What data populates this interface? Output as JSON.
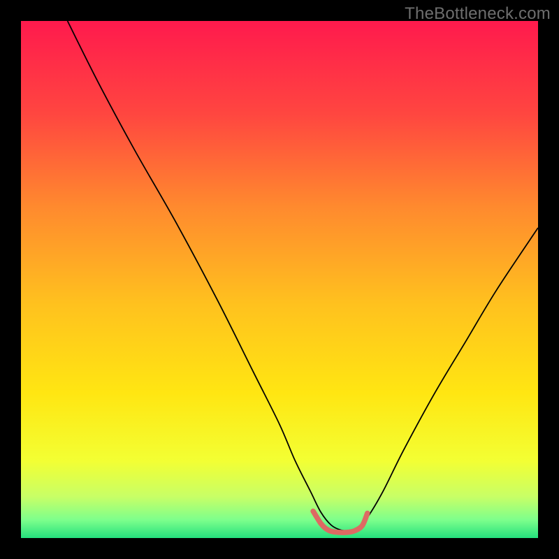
{
  "watermark": "TheBottleneck.com",
  "chart_data": {
    "type": "line",
    "title": "",
    "xlabel": "",
    "ylabel": "",
    "xlim": [
      0,
      100
    ],
    "ylim": [
      0,
      100
    ],
    "grid": false,
    "legend": false,
    "background_gradient_stops": [
      {
        "offset": 0.0,
        "color": "#ff1a4d"
      },
      {
        "offset": 0.18,
        "color": "#ff4640"
      },
      {
        "offset": 0.36,
        "color": "#ff8a2e"
      },
      {
        "offset": 0.55,
        "color": "#ffc21e"
      },
      {
        "offset": 0.72,
        "color": "#ffe612"
      },
      {
        "offset": 0.85,
        "color": "#f3ff33"
      },
      {
        "offset": 0.92,
        "color": "#c8ff66"
      },
      {
        "offset": 0.965,
        "color": "#7dff8c"
      },
      {
        "offset": 1.0,
        "color": "#24e07d"
      }
    ],
    "series": [
      {
        "name": "bottleneck-curve",
        "color": "#000000",
        "width": 1.8,
        "x": [
          9.0,
          15.0,
          22.0,
          30.0,
          38.0,
          45.0,
          50.0,
          53.0,
          56.0,
          58.0,
          60.0,
          62.0,
          63.5,
          65.0,
          67.0,
          70.0,
          74.0,
          80.0,
          86.0,
          92.0,
          100.0
        ],
        "y": [
          100.0,
          88.0,
          75.0,
          61.0,
          46.0,
          32.0,
          22.0,
          15.0,
          9.0,
          5.0,
          2.5,
          1.5,
          1.5,
          2.0,
          4.0,
          9.0,
          17.0,
          28.0,
          38.0,
          48.0,
          60.0
        ]
      },
      {
        "name": "optimal-zone-marker",
        "color": "#dd6a63",
        "width": 7.5,
        "linecap": "round",
        "x": [
          56.5,
          58.0,
          59.0,
          60.0,
          61.5,
          63.0,
          64.5,
          66.0,
          67.0
        ],
        "y": [
          5.2,
          2.8,
          1.8,
          1.3,
          1.1,
          1.1,
          1.4,
          2.4,
          4.8
        ]
      }
    ]
  }
}
